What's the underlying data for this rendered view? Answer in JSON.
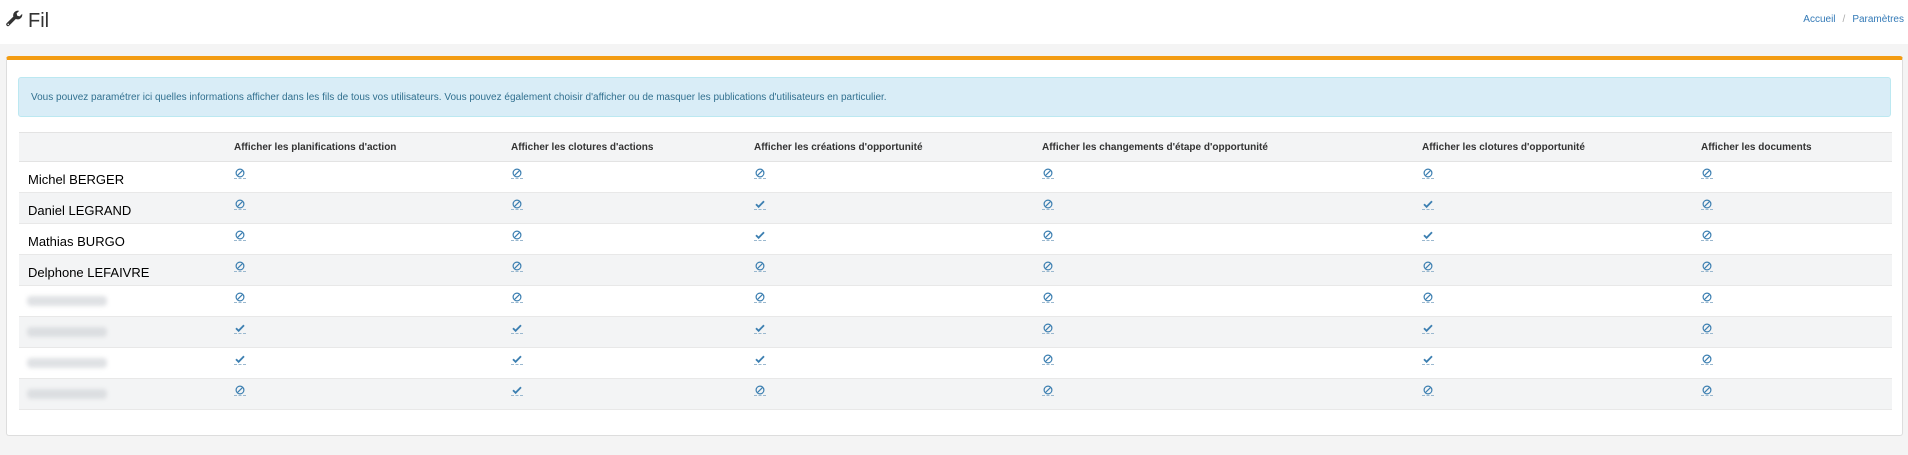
{
  "header": {
    "title": "Fil",
    "title_icon": "wrench-icon",
    "breadcrumb": [
      "Accueil",
      "Paramètres"
    ]
  },
  "info_message": "Vous pouvez paramétrer ici quelles informations afficher dans les fils de tous vos utilisateurs. Vous pouvez également choisir d'afficher ou de masquer les publications d'utilisateurs en particulier.",
  "colors": {
    "accent_top_border": "#f39c12",
    "link": "#337ab7",
    "icon": "#3c7fb1",
    "callout_bg": "#d9edf7"
  },
  "table": {
    "columns": [
      "",
      "Afficher les planifications d'action",
      "Afficher les clotures d'actions",
      "Afficher les créations d'opportunité",
      "Afficher les changements d'étape d'opportunité",
      "Afficher les clotures d'opportunité",
      "Afficher les documents"
    ],
    "legend": {
      "true": "check-icon",
      "false": "ban-icon"
    },
    "rows": [
      {
        "name": "Michel BERGER",
        "values": [
          false,
          false,
          false,
          false,
          false,
          false
        ]
      },
      {
        "name": "Daniel LEGRAND",
        "values": [
          false,
          false,
          true,
          false,
          true,
          false
        ]
      },
      {
        "name": "Mathias BURGO",
        "values": [
          false,
          false,
          true,
          false,
          true,
          false
        ]
      },
      {
        "name": "Delphone LEFAIVRE",
        "values": [
          false,
          false,
          false,
          false,
          false,
          false
        ]
      },
      {
        "name": "",
        "values": [
          false,
          false,
          false,
          false,
          false,
          false
        ]
      },
      {
        "name": "",
        "values": [
          true,
          true,
          true,
          false,
          true,
          false
        ]
      },
      {
        "name": "",
        "values": [
          true,
          true,
          true,
          false,
          true,
          false
        ]
      },
      {
        "name": "",
        "values": [
          false,
          true,
          false,
          false,
          false,
          false
        ]
      }
    ]
  }
}
